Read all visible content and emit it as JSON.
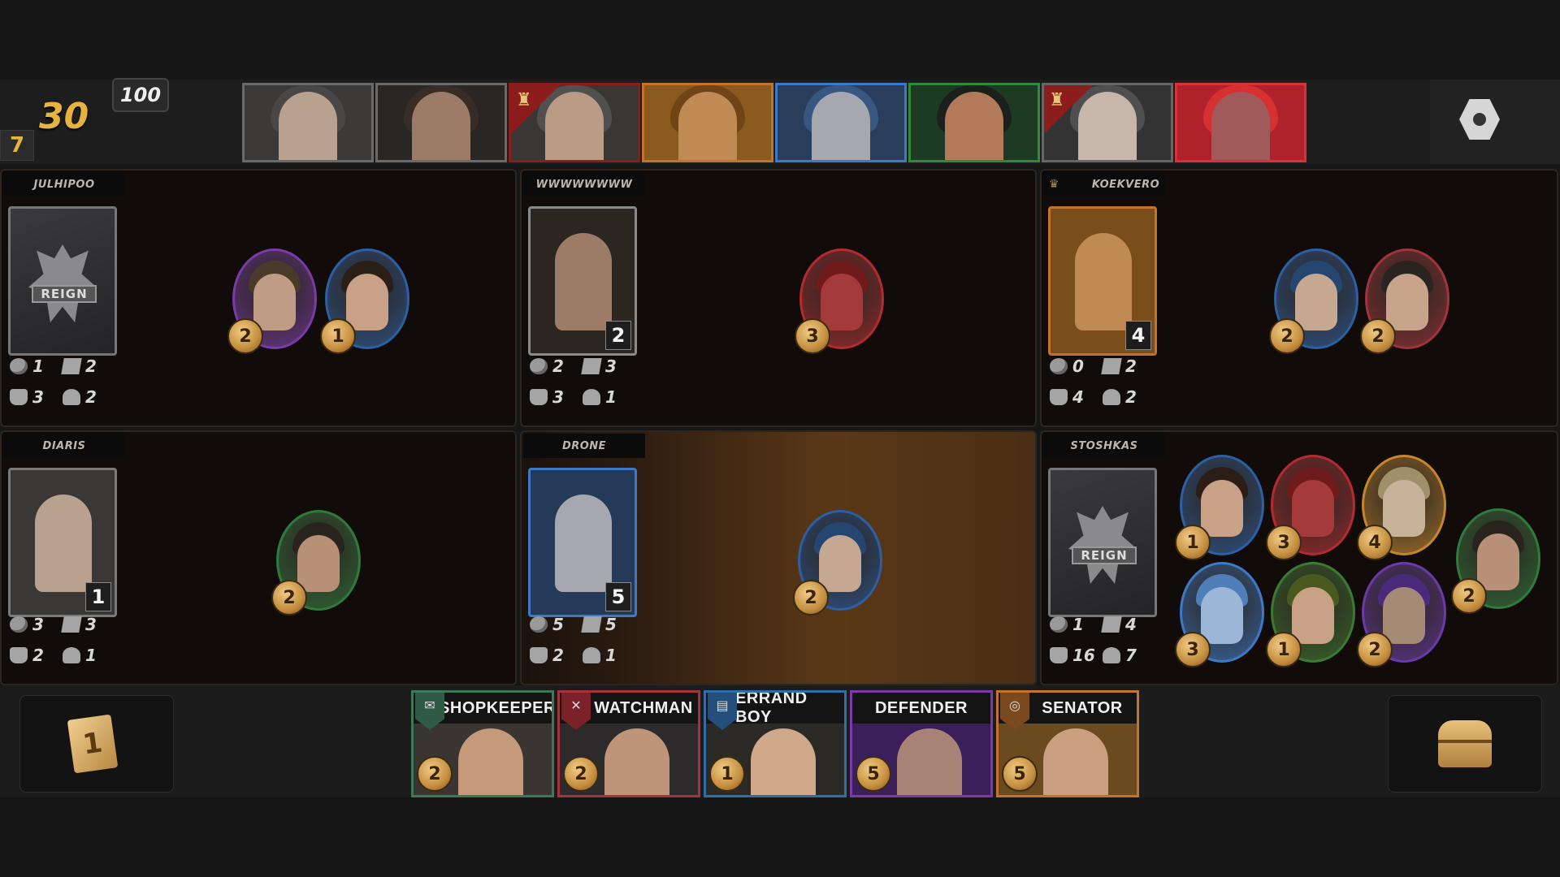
{
  "hud": {
    "gold": "30",
    "round": "7",
    "cap": "100"
  },
  "character_strip": [
    {
      "name": "old-woman-portrait",
      "border": "#6a6a6a",
      "bg": "#3c3a38",
      "skin": "#b9a190",
      "hood": "#4a4a48",
      "crowned": false
    },
    {
      "name": "hooded-assassin-portrait",
      "border": "#6a6a6a",
      "bg": "#2a2623",
      "skin": "#9c7c66",
      "hood": "#3a2f27",
      "crowned": false
    },
    {
      "name": "old-noble-portrait",
      "border": "#8b1d1d",
      "bg": "#3a3634",
      "skin": "#b99b86",
      "hood": "#555",
      "crowned": true
    },
    {
      "name": "merchant-portrait",
      "border": "#c4722c",
      "bg": "#8a5a1e",
      "skin": "#c08a55",
      "hood": "#6a4216",
      "crowned": false
    },
    {
      "name": "wizard-portrait",
      "border": "#3c7ac9",
      "bg": "#2a3d5a",
      "skin": "#a7a7b0",
      "hood": "#3a5b87",
      "crowned": false
    },
    {
      "name": "bearded-ranger-portrait",
      "border": "#2f8a3c",
      "bg": "#1d3a23",
      "skin": "#b27a58",
      "hood": "#1c1c1c",
      "crowned": false
    },
    {
      "name": "white-beard-lord-portrait",
      "border": "#666",
      "bg": "#333",
      "skin": "#c7b7aa",
      "hood": "#555",
      "crowned": true
    },
    {
      "name": "red-warlord-portrait",
      "border": "#d8323a",
      "bg": "#b0222a",
      "skin": "#a05a5a",
      "hood": "#d33",
      "crowned": false
    }
  ],
  "players": [
    {
      "name": "JULHIPOO",
      "crown": false,
      "card": null,
      "active": false,
      "stats": {
        "coins": "1",
        "cards": "2",
        "power": "3",
        "units": "2"
      },
      "tokens": [
        {
          "value": "2",
          "border": "#7a3aa8",
          "skin": "#c19c84",
          "hair": "#4a3a2a"
        },
        {
          "value": "1",
          "border": "#2d5fa3",
          "skin": "#c8a186",
          "hair": "#2a1e16"
        }
      ]
    },
    {
      "name": "WWWWWWWW",
      "crown": false,
      "card": "2",
      "active": false,
      "card_colors": {
        "border": "#8a8a8a",
        "bg": "#2c2621",
        "skin": "#9c7c66"
      },
      "stats": {
        "coins": "2",
        "cards": "3",
        "power": "3",
        "units": "1"
      },
      "tokens": [
        {
          "value": "3",
          "border": "#b32b31",
          "skin": "#a53a3a",
          "hair": "#701b1b"
        }
      ]
    },
    {
      "name": "KOEKVERO",
      "crown": true,
      "card": "4",
      "active": false,
      "card_colors": {
        "border": "#c4722c",
        "bg": "#7a4e1b",
        "skin": "#c08a55"
      },
      "stats": {
        "coins": "0",
        "cards": "2",
        "power": "4",
        "units": "2"
      },
      "tokens": [
        {
          "value": "2",
          "border": "#2d5fa3",
          "skin": "#c6a892",
          "hair": "#244670"
        },
        {
          "value": "2",
          "border": "#a0343a",
          "skin": "#c8a48a",
          "hair": "#2a2420"
        }
      ]
    },
    {
      "name": "DIARIS",
      "crown": false,
      "card": "1",
      "active": false,
      "card_colors": {
        "border": "#7a7a7a",
        "bg": "#3a3836",
        "skin": "#b9a190"
      },
      "stats": {
        "coins": "3",
        "cards": "3",
        "power": "2",
        "units": "1"
      },
      "tokens": [
        {
          "value": "2",
          "border": "#2f7a3c",
          "skin": "#b89078",
          "hair": "#2a241e"
        }
      ]
    },
    {
      "name": "DRONE",
      "crown": false,
      "card": "5",
      "active": true,
      "card_colors": {
        "border": "#3c7ac9",
        "bg": "#243a58",
        "skin": "#a7a7b0"
      },
      "stats": {
        "coins": "5",
        "cards": "5",
        "power": "2",
        "units": "1"
      },
      "tokens": [
        {
          "value": "2",
          "border": "#2d5fa3",
          "skin": "#c6a892",
          "hair": "#244670"
        }
      ]
    },
    {
      "name": "STOSHKAS",
      "crown": false,
      "card": null,
      "active": false,
      "stats": {
        "coins": "1",
        "cards": "4",
        "power": "16",
        "units": "7"
      },
      "tokens": [
        {
          "value": "1",
          "border": "#2d5fa3",
          "skin": "#c8a186",
          "hair": "#2a1e16"
        },
        {
          "value": "3",
          "border": "#b32b31",
          "skin": "#a53a3a",
          "hair": "#701b1b"
        },
        {
          "value": "4",
          "border": "#c4862c",
          "skin": "#c7b29a",
          "hair": "#a0906a"
        },
        {
          "value": "3",
          "border": "#3c7ac9",
          "skin": "#9bb6d6",
          "hair": "#4f7fb8"
        },
        {
          "value": "1",
          "border": "#3c7a2f",
          "skin": "#c8a186",
          "hair": "#4a5a1e"
        },
        {
          "value": "2",
          "border": "#6a3aa8",
          "skin": "#a58a76",
          "hair": "#4a2a7a"
        },
        {
          "value": "2",
          "border": "#2f7a3c",
          "skin": "#b89078",
          "hair": "#2a241e"
        }
      ]
    }
  ],
  "deck": {
    "count": "1"
  },
  "hand": [
    {
      "label": "SHOPKEEPER",
      "cost": "2",
      "border": "#3c7a55",
      "shield": "#2f5a44",
      "icon": "scroll-icon",
      "glyph": "✉",
      "bg": "#3a3530",
      "skin": "#c49a7a"
    },
    {
      "label": "WATCHMAN",
      "cost": "2",
      "border": "#a8323a",
      "shield": "#7a2228",
      "icon": "sword-icon",
      "glyph": "✕",
      "bg": "#2c2a2a",
      "skin": "#bf957a"
    },
    {
      "label": "ERRAND BOY",
      "cost": "1",
      "border": "#2f6fa8",
      "shield": "#244f7a",
      "icon": "book-icon",
      "glyph": "▤",
      "bg": "#2c2a26",
      "skin": "#d0a88a"
    },
    {
      "label": "DEFENDER",
      "cost": "5",
      "border": "#7a3aa8",
      "shield": "#4a2470",
      "icon": "none",
      "glyph": "",
      "bg": "#3b1f5a",
      "skin": "#a88478"
    },
    {
      "label": "SENATOR",
      "cost": "5",
      "border": "#c4722c",
      "shield": "#7a4a1e",
      "icon": "ring-icon",
      "glyph": "◎",
      "bg": "#6a4a1e",
      "skin": "#caa080"
    }
  ]
}
